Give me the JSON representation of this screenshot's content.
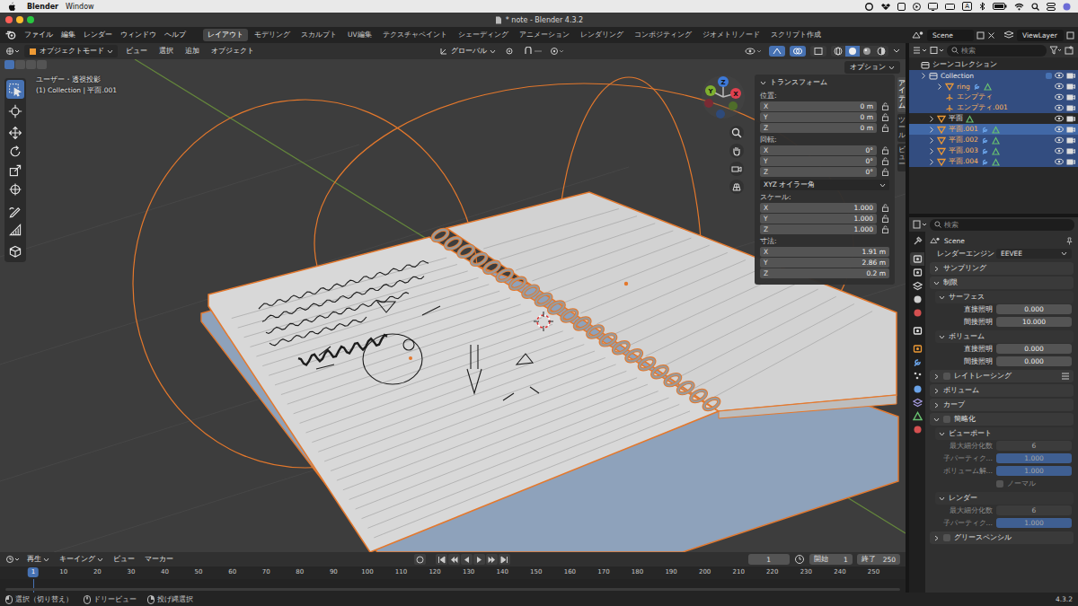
{
  "menubar": {
    "app": "Blender",
    "menus": [
      "Window"
    ],
    "input_source": "A"
  },
  "window": {
    "title": "* note - Blender 4.3.2"
  },
  "topbar": {
    "menus": [
      "ファイル",
      "編集",
      "レンダー",
      "ウィンドウ",
      "ヘルプ"
    ],
    "workspaces": [
      {
        "label": "レイアウト",
        "selected": true
      },
      {
        "label": "モデリング",
        "selected": false
      },
      {
        "label": "スカルプト",
        "selected": false
      },
      {
        "label": "UV編集",
        "selected": false
      },
      {
        "label": "テクスチャペイント",
        "selected": false
      },
      {
        "label": "シェーディング",
        "selected": false
      },
      {
        "label": "アニメーション",
        "selected": false
      },
      {
        "label": "レンダリング",
        "selected": false
      },
      {
        "label": "コンポジティング",
        "selected": false
      },
      {
        "label": "ジオメトリノード",
        "selected": false
      },
      {
        "label": "スクリプト作成",
        "selected": false
      }
    ],
    "scene": "Scene",
    "view_layer": "ViewLayer"
  },
  "viewport": {
    "mode": "オブジェクトモード",
    "menus": [
      "ビュー",
      "選択",
      "追加",
      "オブジェクト"
    ],
    "orientation": "グローバル",
    "options": "オプション",
    "view_name": "ユーザー・透視投影",
    "context": "(1) Collection | 平面.001",
    "gizmo": {
      "x": "X",
      "y": "Y",
      "z": "Z"
    },
    "tools": [
      {
        "kind": "select",
        "selected": true
      },
      {
        "kind": "cursor",
        "selected": false
      },
      {
        "kind": "move",
        "selected": false
      },
      {
        "kind": "rotate",
        "selected": false
      },
      {
        "kind": "scale",
        "selected": false
      },
      {
        "kind": "transform",
        "selected": false
      },
      {
        "kind": "annotate",
        "selected": false
      },
      {
        "kind": "measure",
        "selected": false
      },
      {
        "kind": "add",
        "selected": false
      }
    ],
    "side_tabs": [
      {
        "label": "アイテム",
        "selected": true
      },
      {
        "label": "ツール",
        "selected": false
      },
      {
        "label": "ビュー",
        "selected": false
      }
    ]
  },
  "transform": {
    "title": "トランスフォーム",
    "groups": [
      {
        "label": "位置:",
        "locks": true,
        "rows": [
          {
            "axis": "X",
            "value": "0 m"
          },
          {
            "axis": "Y",
            "value": "0 m"
          },
          {
            "axis": "Z",
            "value": "0 m"
          }
        ]
      },
      {
        "label": "回転:",
        "locks": true,
        "rows": [
          {
            "axis": "X",
            "value": "0°"
          },
          {
            "axis": "Y",
            "value": "0°"
          },
          {
            "axis": "Z",
            "value": "0°"
          }
        ],
        "mode": "XYZ オイラー角"
      },
      {
        "label": "スケール:",
        "locks": true,
        "rows": [
          {
            "axis": "X",
            "value": "1.000"
          },
          {
            "axis": "Y",
            "value": "1.000"
          },
          {
            "axis": "Z",
            "value": "1.000"
          }
        ]
      },
      {
        "label": "寸法:",
        "locks": false,
        "rows": [
          {
            "axis": "X",
            "value": "1.91 m"
          },
          {
            "axis": "Y",
            "value": "2.86 m"
          },
          {
            "axis": "Z",
            "value": "0.2 m"
          }
        ]
      }
    ]
  },
  "outliner": {
    "search_placeholder": "検索",
    "rows": [
      {
        "label": "シーンコレクション",
        "kind": "scene",
        "level": 0,
        "expandable": false,
        "selected": false,
        "active": false,
        "modifier": false,
        "mesh_data": false
      },
      {
        "label": "Collection",
        "kind": "collection",
        "level": 1,
        "expandable": true,
        "selected": true,
        "active": false,
        "modifier": false,
        "mesh_data": false,
        "enabled": true,
        "visible": true,
        "renderable": true
      },
      {
        "label": "ring",
        "kind": "mesh",
        "level": 3,
        "expandable": true,
        "selected": true,
        "active": false,
        "modifier": true,
        "mesh_data": true,
        "visible": true,
        "renderable": true
      },
      {
        "label": "エンプティ",
        "kind": "empty",
        "level": 3,
        "expandable": false,
        "selected": true,
        "active": false,
        "modifier": false,
        "mesh_data": false,
        "visible": true,
        "renderable": true
      },
      {
        "label": "エンプティ.001",
        "kind": "empty",
        "level": 3,
        "expandable": false,
        "selected": true,
        "active": false,
        "modifier": false,
        "mesh_data": false,
        "visible": true,
        "renderable": true
      },
      {
        "label": "平面",
        "kind": "mesh",
        "level": 2,
        "expandable": true,
        "selected": false,
        "active": false,
        "modifier": false,
        "mesh_data": true,
        "visible": true,
        "renderable": true
      },
      {
        "label": "平面.001",
        "kind": "mesh",
        "level": 2,
        "expandable": true,
        "selected": true,
        "active": true,
        "modifier": true,
        "mesh_data": true,
        "visible": true,
        "renderable": true
      },
      {
        "label": "平面.002",
        "kind": "mesh",
        "level": 2,
        "expandable": true,
        "selected": true,
        "active": false,
        "modifier": true,
        "mesh_data": true,
        "visible": true,
        "renderable": true
      },
      {
        "label": "平面.003",
        "kind": "mesh",
        "level": 2,
        "expandable": true,
        "selected": true,
        "active": false,
        "modifier": true,
        "mesh_data": true,
        "visible": true,
        "renderable": true
      },
      {
        "label": "平面.004",
        "kind": "mesh",
        "level": 2,
        "expandable": true,
        "selected": true,
        "active": false,
        "modifier": true,
        "mesh_data": true,
        "visible": true,
        "renderable": true
      }
    ]
  },
  "properties": {
    "search_placeholder": "検索",
    "context": "Scene",
    "tabs": [
      {
        "kind": "tool",
        "selected": false
      },
      {
        "kind": "render",
        "selected": true
      },
      {
        "kind": "output",
        "selected": false
      },
      {
        "kind": "view_layer",
        "selected": false
      },
      {
        "kind": "scene",
        "selected": false
      },
      {
        "kind": "world",
        "selected": false
      },
      {
        "kind": "collection",
        "selected": false
      },
      {
        "kind": "object",
        "selected": false
      },
      {
        "kind": "modifier",
        "selected": false
      },
      {
        "kind": "particles",
        "selected": false
      },
      {
        "kind": "physics",
        "selected": false
      },
      {
        "kind": "constraints",
        "selected": false
      },
      {
        "kind": "data",
        "selected": false
      },
      {
        "kind": "material",
        "selected": false
      }
    ],
    "engine": {
      "label": "レンダーエンジン",
      "value": "EEVEE"
    },
    "panels": [
      {
        "title": "サンプリング",
        "expanded": false,
        "subpanels": []
      },
      {
        "title": "制限",
        "expanded": true,
        "subpanels": [
          {
            "title": "サーフェス",
            "expanded": true,
            "fields": [
              {
                "kind": "number",
                "label": "直接照明",
                "value": "0.000",
                "disabled": false
              },
              {
                "kind": "number",
                "label": "間接照明",
                "value": "10.000",
                "disabled": false
              }
            ]
          },
          {
            "title": "ボリューム",
            "expanded": true,
            "fields": [
              {
                "kind": "number",
                "label": "直接照明",
                "value": "0.000",
                "disabled": false
              },
              {
                "kind": "number",
                "label": "間接照明",
                "value": "0.000",
                "disabled": false
              }
            ]
          }
        ]
      },
      {
        "title": "レイトレーシング",
        "expanded": false,
        "checkbox": false,
        "presets": true,
        "subpanels": []
      },
      {
        "title": "ボリューム",
        "expanded": false,
        "subpanels": []
      },
      {
        "title": "カーブ",
        "expanded": false,
        "subpanels": []
      },
      {
        "title": "簡略化",
        "expanded": true,
        "checkbox": false,
        "subpanels": [
          {
            "title": "ビューポート",
            "expanded": true,
            "fields": [
              {
                "kind": "number",
                "label": "最大細分化数",
                "value": "6",
                "disabled": true
              },
              {
                "kind": "slider",
                "label": "子パーティク…",
                "value": "1.000",
                "level": 1,
                "disabled": true
              },
              {
                "kind": "slider",
                "label": "ボリューム解…",
                "value": "1.000",
                "level": 1,
                "disabled": true
              },
              {
                "kind": "checkbox",
                "label": "ノーマル",
                "checked": false,
                "disabled": true
              }
            ]
          },
          {
            "title": "レンダー",
            "expanded": true,
            "fields": [
              {
                "kind": "number",
                "label": "最大細分化数",
                "value": "6",
                "disabled": true
              },
              {
                "kind": "slider",
                "label": "子パーティク…",
                "value": "1.000",
                "level": 1,
                "disabled": true
              }
            ]
          }
        ]
      },
      {
        "title": "グリースペンシル",
        "expanded": false,
        "checkbox": false,
        "subpanels": []
      }
    ]
  },
  "timeline": {
    "menus": [
      {
        "label": "再生",
        "dropdown": true
      },
      {
        "label": "キーイング",
        "dropdown": true
      },
      {
        "label": "ビュー",
        "dropdown": false
      },
      {
        "label": "マーカー",
        "dropdown": false
      }
    ],
    "current_frame": "1",
    "start_label": "開始",
    "start": "1",
    "end_label": "終了",
    "end": "250",
    "ticks": [
      "1",
      "10",
      "20",
      "30",
      "40",
      "50",
      "60",
      "70",
      "80",
      "90",
      "100",
      "110",
      "120",
      "130",
      "140",
      "150",
      "160",
      "170",
      "180",
      "190",
      "200",
      "210",
      "220",
      "230",
      "240",
      "250"
    ]
  },
  "status": {
    "items": [
      "選択（切り替え）",
      "ドリービュー",
      "投げ縄選択"
    ],
    "version": "4.3.2"
  }
}
